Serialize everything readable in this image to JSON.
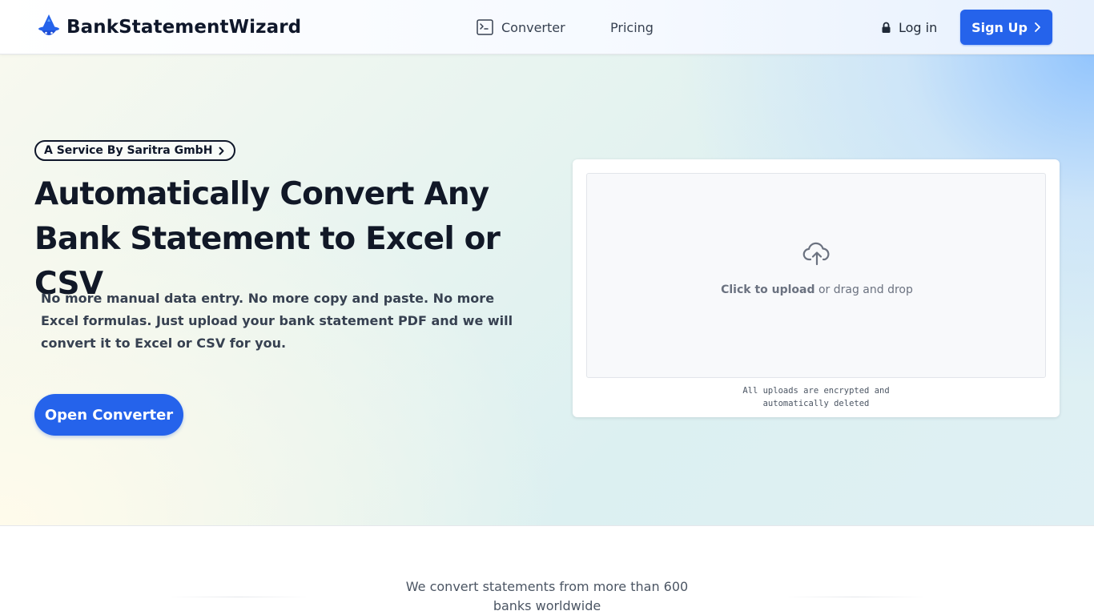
{
  "header": {
    "brand": "BankStatementWizard",
    "logo_icon": "wizard-hat-icon",
    "nav": [
      {
        "label": "Converter",
        "icon": "terminal-icon"
      },
      {
        "label": "Pricing"
      }
    ],
    "login_label": "Log in",
    "login_icon": "lock-icon",
    "signup_label": "Sign Up",
    "signup_icon": "chevron-right-icon"
  },
  "hero": {
    "badge_label": "A Service By Saritra GmbH",
    "headline_line1": "Automatically Convert Any",
    "headline_line2": "Bank Statement to Excel or CSV",
    "subtext": "No more manual data entry. No more copy and paste. No more Excel formulas. Just upload your bank statement PDF and we will convert it to Excel or CSV for you.",
    "cta_label": "Open Converter"
  },
  "upload": {
    "icon": "cloud-upload-icon",
    "click_label": "Click to upload",
    "drag_label": " or drag and drop",
    "note_line1": "All uploads are encrypted and",
    "note_line2": "automatically deleted"
  },
  "banks": {
    "text": "We convert statements from more than 600 banks worldwide"
  },
  "colors": {
    "primary": "#2563eb",
    "text_dark": "#111827",
    "text_muted": "#6b7280"
  }
}
